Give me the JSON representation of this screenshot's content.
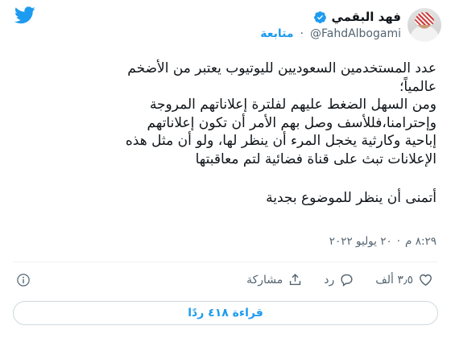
{
  "header": {
    "name": "فهد البقمي",
    "handle": "@FahdAlbogami",
    "separator": "·",
    "follow_label": "متابعة"
  },
  "tweet": {
    "lines": [
      "عدد المستخدمين السعوديين لليوتيوب يعتبر من الأضخم",
      "عالمياً؛",
      "ومن السهل الضغط عليهم لفلترة إعلاناتهم المروجة",
      "وإحترامنا،فللأسف وصل بهم الأمر أن تكون إعلاناتهم",
      "إباحية وكارثية يخجل المرء أن ينظر لها، ولو أن مثل هذه",
      "الإعلانات تبث على قناة فضائية لتم معاقبتها"
    ],
    "closing": "أتمنى أن ينظر للموضوع بجدية"
  },
  "meta": {
    "time": "٨:٢٩ م",
    "separator": "·",
    "date": "٢٠ يوليو ٢٠٢٢"
  },
  "actions": {
    "like_count": "٣٫٥ ألف",
    "reply_label": "رد",
    "share_label": "مشاركة"
  },
  "replies_button": "قراءة ٤١٨ ردًا",
  "colors": {
    "accent": "#1d9bf0",
    "secondary_text": "#536471",
    "border": "#cfd9de"
  }
}
